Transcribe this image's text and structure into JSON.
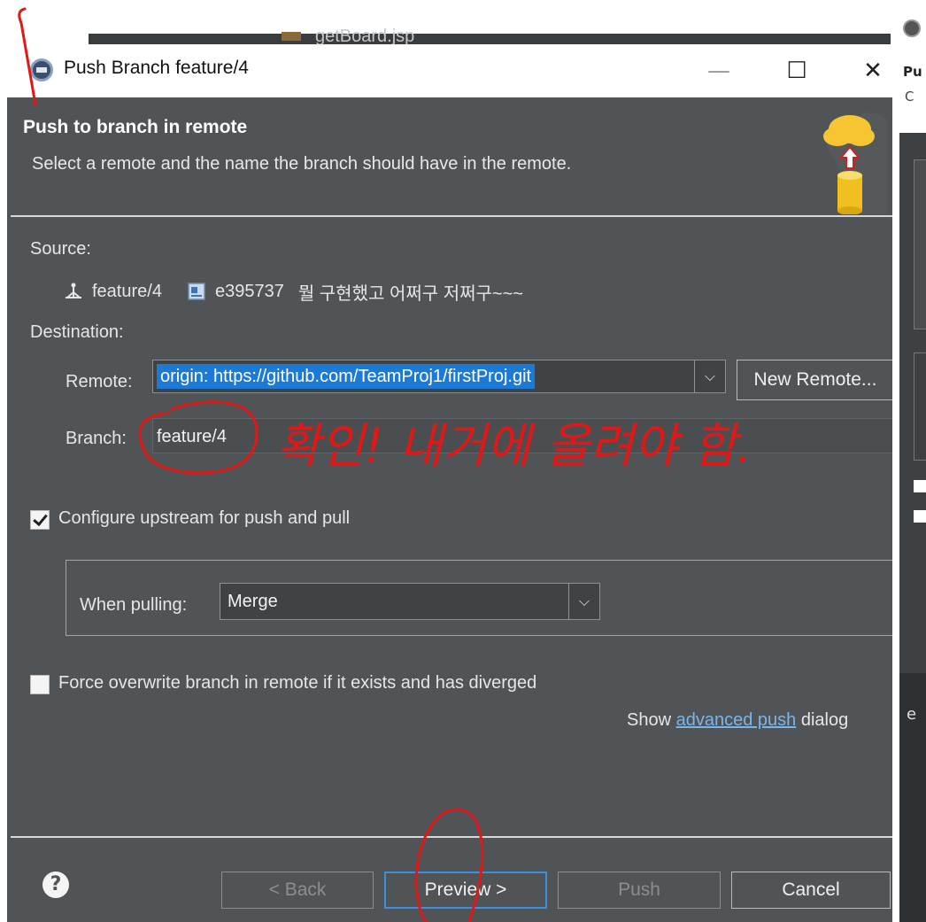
{
  "background": {
    "tab_title": "getBoard.jsp",
    "right_panel": {
      "title_fragment": "Pu",
      "subtitle_fragment": "C",
      "side_letter": "e"
    }
  },
  "dialog": {
    "title": "Push Branch feature/4",
    "window_controls": {
      "minimize": "—",
      "maximize": "☐",
      "close": "✕"
    },
    "header": {
      "title": "Push to branch in remote",
      "description": "Select a remote and the name the branch should have in the remote."
    },
    "source": {
      "label": "Source:",
      "branch": "feature/4",
      "commit_id": "e395737",
      "commit_message": "뭘 구현했고 어쩌구 저쩌구~~~"
    },
    "destination": {
      "label": "Destination:",
      "remote_label": "Remote:",
      "remote_value": "origin: https://github.com/TeamProj1/firstProj.git",
      "new_remote_button": "New Remote...",
      "branch_label": "Branch:",
      "branch_value": "feature/4"
    },
    "configure_upstream": {
      "label": "Configure upstream for push and pull",
      "checked": true
    },
    "when_pulling": {
      "label": "When pulling:",
      "value": "Merge"
    },
    "force_overwrite": {
      "label": "Force overwrite branch in remote if it exists and has diverged",
      "checked": false
    },
    "advanced": {
      "prefix": "Show",
      "link": "advanced push",
      "suffix": "dialog"
    },
    "buttons": {
      "help": "?",
      "back": "< Back",
      "preview": "Preview >",
      "push": "Push",
      "cancel": "Cancel"
    }
  },
  "annotation": {
    "handwritten_note": "확인! 내거에 올려야 함.",
    "color": "#e01818"
  }
}
